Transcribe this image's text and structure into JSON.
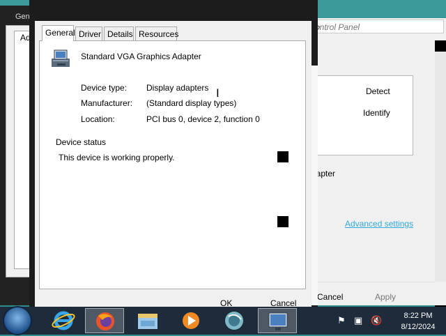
{
  "background_window": {
    "title_partial": "Gen",
    "tab_partial": "Ad",
    "search_placeholder_partial": "ontrol Panel",
    "detect_label": "Detect",
    "identify_label": "Identify",
    "adapter_partial": "dapter",
    "advanced_link": "Advanced settings",
    "cancel_label": "Cancel",
    "apply_label": "Apply"
  },
  "dialog": {
    "tabs": [
      {
        "label": "General",
        "active": true
      },
      {
        "label": "Driver",
        "active": false
      },
      {
        "label": "Details",
        "active": false
      },
      {
        "label": "Resources",
        "active": false
      }
    ],
    "device_name": "Standard VGA Graphics Adapter",
    "device_icon": "display-adapter-icon",
    "properties": [
      {
        "label": "Device type:",
        "value": "Display adapters"
      },
      {
        "label": "Manufacturer:",
        "value": "(Standard display types)"
      },
      {
        "label": "Location:",
        "value": "PCI bus 0, device 2, function 0"
      }
    ],
    "status_heading": "Device status",
    "status_text": "This device is working properly.",
    "ok_label": "OK",
    "cancel_label": "Cancel"
  },
  "taskbar": {
    "time": "8:22 PM",
    "date": "8/12/2024",
    "apps": [
      "internet-explorer-icon",
      "firefox-icon",
      "file-explorer-icon",
      "media-player-icon",
      "network-icon",
      "display-settings-icon"
    ]
  }
}
